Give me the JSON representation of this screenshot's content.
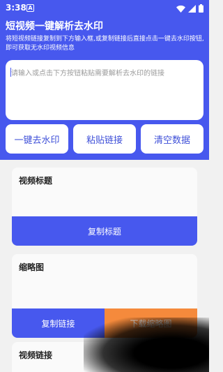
{
  "status": {
    "time": "3:38",
    "badge": "A"
  },
  "app": {
    "title": "短视频一键解析去水印",
    "description": "将短视频链接复制到下方输入框,或复制链接后直接点击一键去水印按钮,即可获取无水印视频信息"
  },
  "input": {
    "placeholder": "请输入或点击下方按钮粘贴需要解析去水印的链接"
  },
  "actions": {
    "remove_watermark": "一键去水印",
    "paste_link": "粘贴链接",
    "clear_data": "清空数据"
  },
  "cards": {
    "video_title": {
      "label": "视频标题",
      "button": "复制标题"
    },
    "thumbnail": {
      "label": "缩略图",
      "copy_button": "复制链接",
      "download_button": "下载缩略图"
    },
    "video_link": {
      "label": "视频链接"
    }
  },
  "colors": {
    "primary": "#4758ee",
    "accent": "#f58a3c",
    "background": "#f1f1f1"
  }
}
